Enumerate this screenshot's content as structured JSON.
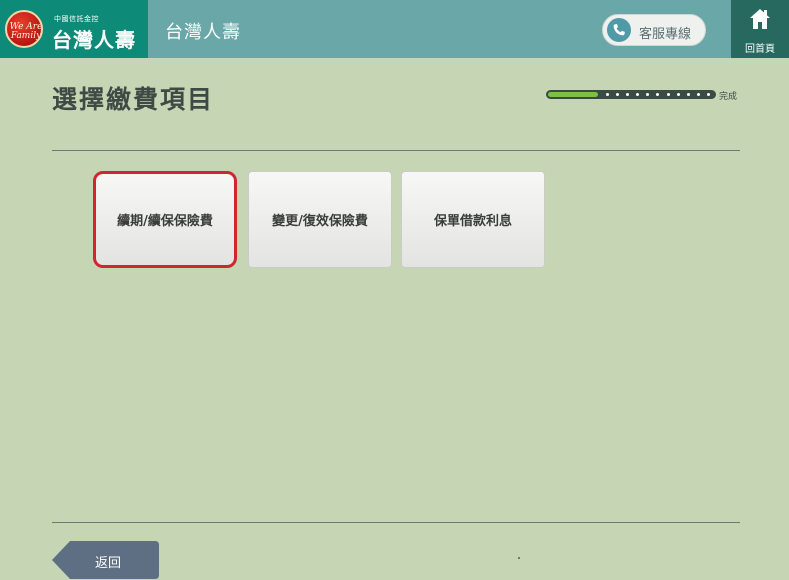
{
  "header": {
    "logo_emblem_text": "We Are Family",
    "logo_subtitle": "中國信託金控",
    "logo_title": "台灣人壽",
    "title": "台灣人壽",
    "service_label": "客服專線",
    "home_label": "回首頁"
  },
  "main": {
    "page_title": "選擇繳費項目",
    "progress": {
      "fraction": 0.3,
      "dots": 11,
      "label": "完成"
    },
    "choices": [
      {
        "label": "續期/續保保險費",
        "selected": true
      },
      {
        "label": "變更/復效保險費",
        "selected": false
      },
      {
        "label": "保單借款利息",
        "selected": false
      }
    ]
  },
  "footer": {
    "back_label": "返回"
  },
  "colors": {
    "background": "#c6d5b4",
    "header": "#6aa7a9",
    "logo_box": "#0e8a78",
    "home_button": "#27685f",
    "selected_border": "#d0262f",
    "progress_fill": "#7cc241"
  }
}
